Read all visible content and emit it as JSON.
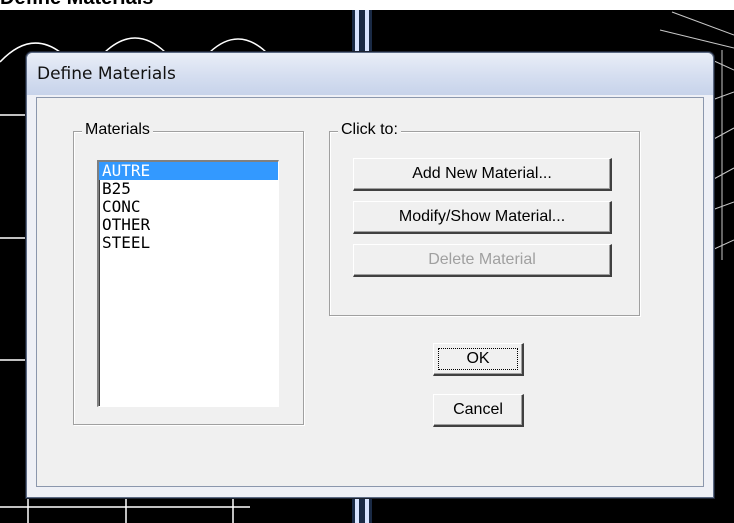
{
  "page": {
    "clipped_heading": "Define Materials"
  },
  "dialog": {
    "title": "Define Materials",
    "materials_group_label": "Materials",
    "materials": [
      {
        "name": "AUTRE",
        "selected": true
      },
      {
        "name": "B25",
        "selected": false
      },
      {
        "name": "CONC",
        "selected": false
      },
      {
        "name": "OTHER",
        "selected": false
      },
      {
        "name": "STEEL",
        "selected": false
      }
    ],
    "click_group_label": "Click to:",
    "add_new_material_label": "Add New Material...",
    "modify_show_material_label": "Modify/Show Material...",
    "delete_material_label": "Delete Material",
    "ok_label": "OK",
    "cancel_label": "Cancel"
  },
  "colors": {
    "selection": "#3399ff",
    "dialog_bg": "#f0f0f0",
    "background": "#000000"
  }
}
